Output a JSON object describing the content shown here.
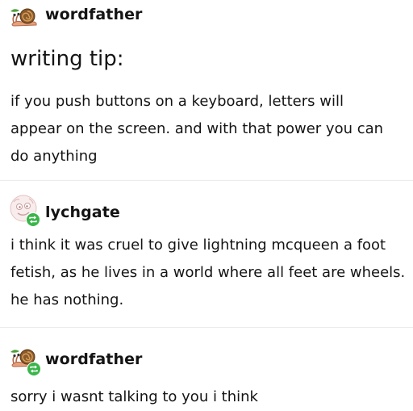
{
  "posts": [
    {
      "username": "wordfather",
      "avatar_icon": "snail-avatar-icon",
      "title": "writing tip:",
      "body": "if you push buttons on a keyboard, letters will appear on the screen. and with that power you can do anything"
    },
    {
      "username": "lychgate",
      "avatar_icon": "cartoon-face-avatar-icon",
      "reblog_icon": "reblog-icon",
      "body": "i think it was cruel to give lightning mcqueen a foot fetish, as he lives in a world where all feet are wheels. he has nothing."
    },
    {
      "username": "wordfather",
      "avatar_icon": "snail-avatar-icon",
      "reblog_icon": "reblog-icon",
      "body": "sorry i wasnt talking to you i think"
    }
  ],
  "colors": {
    "text": "#141414",
    "divider": "#ececec",
    "reblog_green": "#3ab54a",
    "background": "#ffffff"
  }
}
